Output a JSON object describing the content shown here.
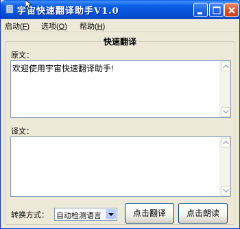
{
  "window": {
    "title": "宇宙快速翻译助手V1.0"
  },
  "menu": [
    {
      "label": "启动",
      "key": "F"
    },
    {
      "label": "选项",
      "key": "O"
    },
    {
      "label": "帮助",
      "key": "H"
    }
  ],
  "group": {
    "title": "快速翻译"
  },
  "source": {
    "label": "原文：",
    "text": "欢迎使用宇宙快速翻译助手!"
  },
  "target": {
    "label": "译文：",
    "text": ""
  },
  "controls": {
    "mode_label": "转换方式：",
    "mode_value": "自动检测语言",
    "translate_button": "点击翻译",
    "read_button": "点击朗读"
  },
  "colors": {
    "titlebar": "#0552d8",
    "window_bg": "#ece9d8",
    "close_button": "#d9512c"
  }
}
